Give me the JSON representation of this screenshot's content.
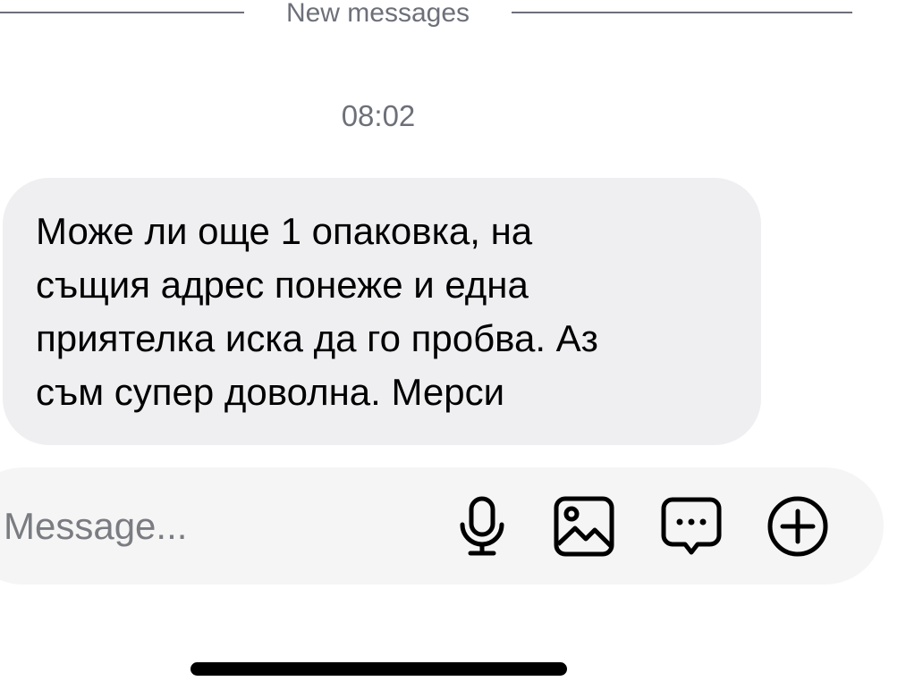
{
  "divider": {
    "label": "New messages"
  },
  "timestamp": "08:02",
  "message": {
    "text": "Може ли още 1 опаковка, на\nсъщия адрес понеже и една\nприятелка иска да го пробва. Аз\nсъм супер доволна. Мерси"
  },
  "composer": {
    "placeholder": "Message...",
    "value": "",
    "icons": [
      "microphone-icon",
      "image-icon",
      "sticker-chat-icon",
      "add-icon"
    ]
  },
  "colors": {
    "bubble": "#efeff2",
    "composer": "#f5f5f5",
    "muted_text": "#6d7079"
  }
}
